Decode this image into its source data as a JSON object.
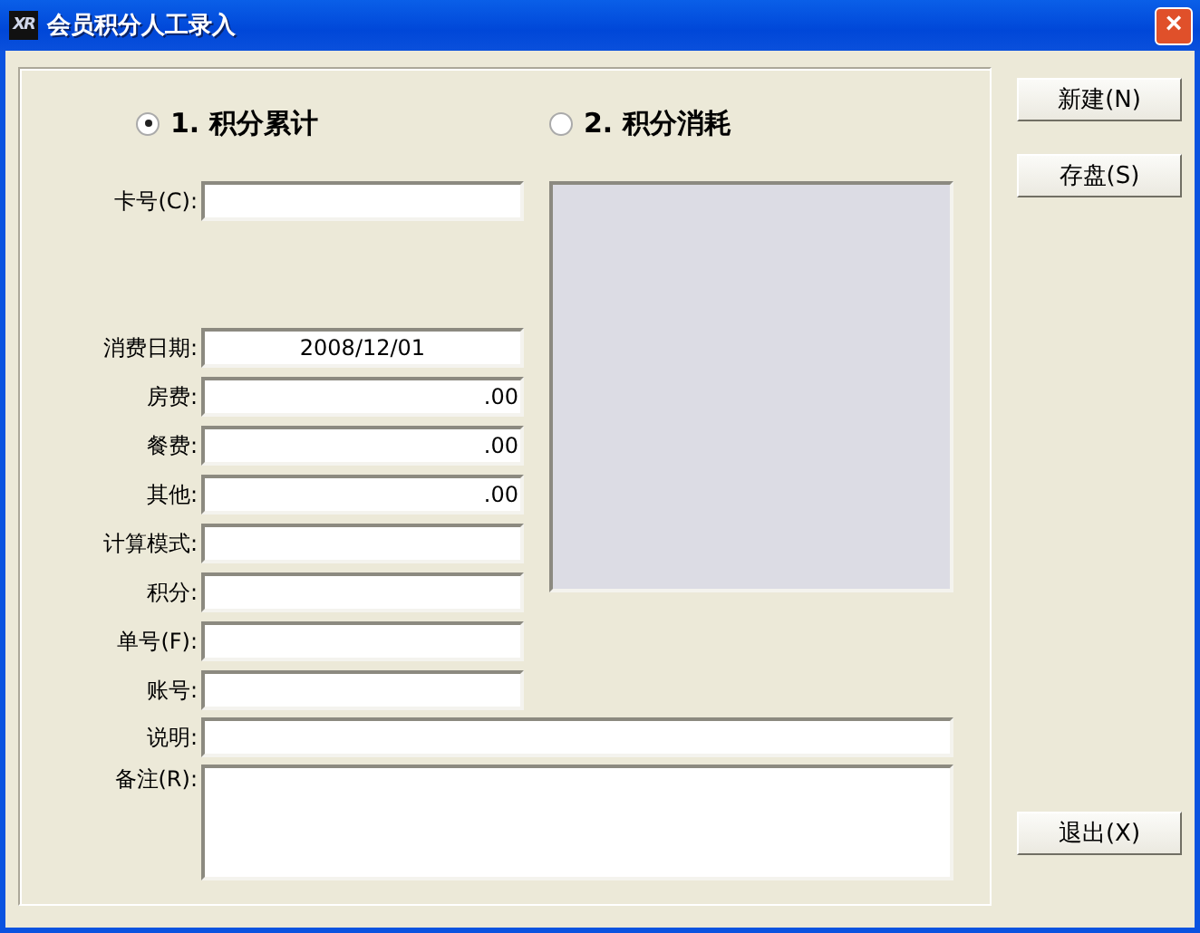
{
  "window": {
    "title": "会员积分人工录入",
    "logo": "XR",
    "close": "×"
  },
  "modes": [
    {
      "label": "1. 积分累计",
      "selected": true
    },
    {
      "label": "2. 积分消耗",
      "selected": false
    }
  ],
  "card": {
    "label": "卡号(C):"
  },
  "fields": [
    {
      "label": "消费日期:",
      "value": "2008/12/01",
      "kind": "date"
    },
    {
      "label": "房费:",
      "value": ".00",
      "kind": "amount"
    },
    {
      "label": "餐费:",
      "value": ".00",
      "kind": "amount"
    },
    {
      "label": "其他:",
      "value": ".00",
      "kind": "amount"
    },
    {
      "label": "计算模式:",
      "kind": "text"
    },
    {
      "label": "积分:",
      "kind": "text"
    },
    {
      "label": "单号(F):",
      "kind": "text"
    },
    {
      "label": "账号:",
      "kind": "text"
    }
  ],
  "description": {
    "label": "说明:"
  },
  "remarks": {
    "label": "备注(R):"
  },
  "buttons": [
    {
      "label": "新建(N)",
      "kind": "top"
    },
    {
      "label": "存盘(S)",
      "kind": "top"
    },
    {
      "label": "退出(X)",
      "kind": "bottom"
    }
  ]
}
